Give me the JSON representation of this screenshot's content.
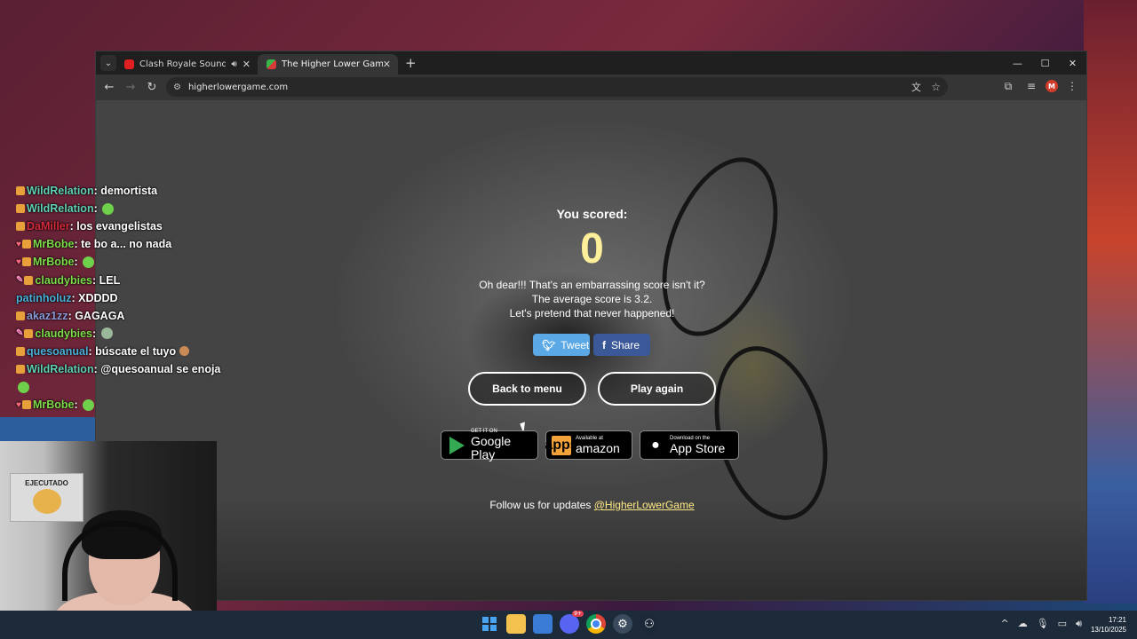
{
  "browser": {
    "tabs": [
      {
        "title": "Clash Royale Soundtrack - (",
        "active": false,
        "audio": true
      },
      {
        "title": "The Higher Lower Game",
        "active": true,
        "audio": false
      }
    ],
    "url": "higherlowergame.com",
    "profile_initial": "M"
  },
  "game": {
    "you_scored": "You scored:",
    "score": "0",
    "message_line1": "Oh dear!!! That's an embarrassing score isn't it?",
    "message_line2": "The average score is 3.2.",
    "message_line3": "Let's pretend that never happened!",
    "tweet_label": "Tweet",
    "share_label": "Share",
    "back_to_menu": "Back to menu",
    "play_again": "Play again",
    "stores": {
      "google_small": "GET IT ON",
      "google_big": "Google Play",
      "amazon_small": "Available at",
      "amazon_big": "amazon",
      "apple_small": "Download on the",
      "apple_big": "App Store"
    },
    "follow_text": "Follow us for updates ",
    "follow_link": "@HigherLowerGame"
  },
  "chat": [
    {
      "user": "WildRelation",
      "color": "#5fd0b4",
      "msg": "demortista",
      "heart": false,
      "pencil": false,
      "emote": ""
    },
    {
      "user": "WildRelation",
      "color": "#5fd0b4",
      "msg": "",
      "heart": false,
      "pencil": false,
      "emote": "green"
    },
    {
      "user": "DaMiller",
      "color": "#d22a3a",
      "msg": "los evangelistas",
      "heart": false,
      "pencil": false,
      "emote": ""
    },
    {
      "user": "MrBobe",
      "color": "#7ddc4a",
      "msg": "te bo a... no nada",
      "heart": true,
      "pencil": false,
      "emote": ""
    },
    {
      "user": "MrBobe",
      "color": "#7ddc4a",
      "msg": "",
      "heart": true,
      "pencil": false,
      "emote": "green"
    },
    {
      "user": "claudybies",
      "color": "#7ddc4a",
      "msg": "LEL",
      "heart": false,
      "pencil": true,
      "emote": ""
    },
    {
      "user": "patinholuz",
      "color": "#4ab0d8",
      "msg": "XDDDD",
      "heart": false,
      "pencil": false,
      "emote": ""
    },
    {
      "user": "akaz1zz",
      "color": "#8a9ad8",
      "msg": "GAGAGA",
      "heart": false,
      "pencil": false,
      "emote": ""
    },
    {
      "user": "claudybies",
      "color": "#7ddc4a",
      "msg": "",
      "heart": false,
      "pencil": true,
      "emote": "gray"
    },
    {
      "user": "quesoanual",
      "color": "#4ab0d8",
      "msg": "búscate el tuyo",
      "heart": false,
      "pencil": false,
      "emote": "face"
    },
    {
      "user": "WildRelation",
      "color": "#5fd0b4",
      "msg": "@quesoanual se enoja",
      "heart": false,
      "pencil": false,
      "emote": ""
    },
    {
      "user": "",
      "color": "#5fd0b4",
      "msg": "",
      "heart": false,
      "pencil": false,
      "emote": "green"
    },
    {
      "user": "MrBobe",
      "color": "#7ddc4a",
      "msg": "",
      "heart": true,
      "pencil": false,
      "emote": "green"
    }
  ],
  "webcam": {
    "poster_text": "EJECUTADO"
  },
  "taskbar": {
    "discord_badge": "9+",
    "time": "17:21",
    "date": "13/10/2025"
  }
}
